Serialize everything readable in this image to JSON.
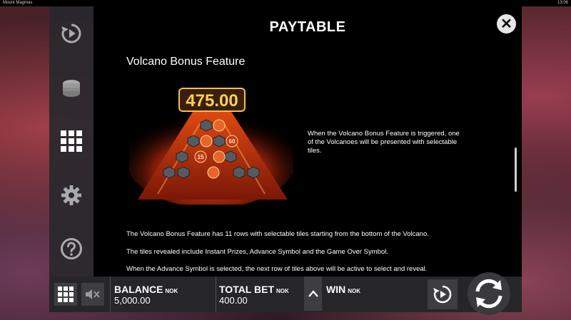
{
  "window": {
    "title": "Mount Magmas",
    "clock": "13:06"
  },
  "sidebar": {
    "items": [
      {
        "icon": "replay-icon"
      },
      {
        "icon": "coins-icon"
      },
      {
        "icon": "grid-icon"
      },
      {
        "icon": "gear-icon"
      },
      {
        "icon": "help-icon"
      }
    ]
  },
  "panel": {
    "title": "PAYTABLE",
    "close_label": "✕",
    "section_title": "Volcano Bonus Feature",
    "image": {
      "prize": "475.00",
      "tile_values": [
        "60",
        "15"
      ]
    },
    "side_text": "When the Volcano Bonus Feature is triggered, one of the Volcanoes will be presented with selectable tiles.",
    "paragraphs": [
      "The Volcano Bonus Feature has 11 rows with selectable tiles starting from the bottom of the Volcano.",
      "The tiles revealed include Instant Prizes, Advance Symbol and the Game Over Symbol.",
      "When the Advance Symbol is selected, the next row of tiles above will be active to select and reveal."
    ]
  },
  "bottom": {
    "balance": {
      "label": "BALANCE",
      "unit": "NOK",
      "value": "5,000.00"
    },
    "total_bet": {
      "label": "TOTAL BET",
      "unit": "NOK",
      "value": "400.00"
    },
    "win": {
      "label": "WIN",
      "unit": "NOK"
    }
  },
  "colors": {
    "accent": "#f2b233",
    "panel": "#000000",
    "bar": "#262628"
  }
}
